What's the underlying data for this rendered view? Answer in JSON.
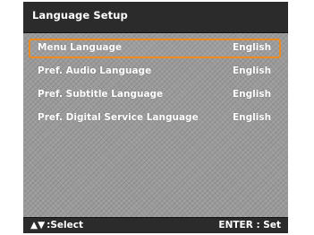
{
  "title": "Language Setup",
  "rows": [
    {
      "label": "Menu Language",
      "value": "English",
      "selected": true
    },
    {
      "label": "Pref. Audio Language",
      "value": "English",
      "selected": false
    },
    {
      "label": "Pref. Subtitle Language",
      "value": "English",
      "selected": false
    },
    {
      "label": "Pref. Digital Service Language",
      "value": "English",
      "selected": false
    }
  ],
  "footer": {
    "select_arrows": "▲▼",
    "select_label": ":Select",
    "enter_label": "ENTER : Set"
  },
  "colors": {
    "selection_border": "#f08a1c",
    "title_bar": "#2b2b2b",
    "content_bg": "#9a9a9a"
  }
}
